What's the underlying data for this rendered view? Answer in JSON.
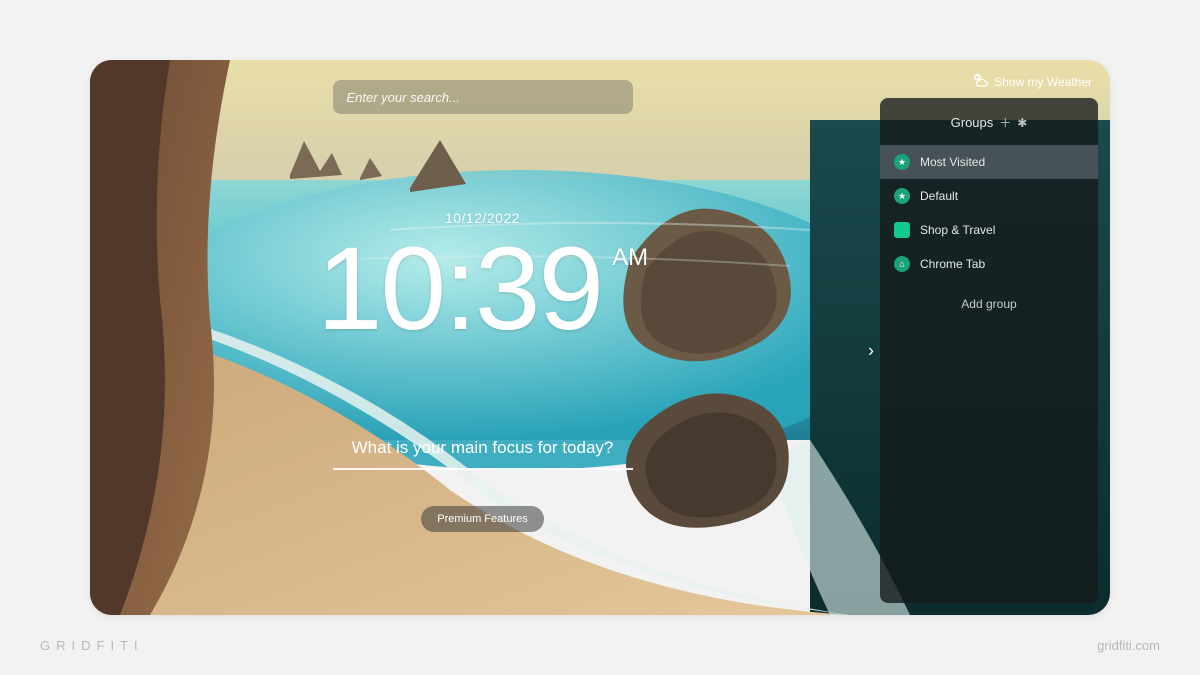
{
  "brand": {
    "left": "GRIDFITI",
    "right": "gridfiti.com"
  },
  "search": {
    "placeholder": "Enter your search..."
  },
  "weather": {
    "label": "Show my Weather"
  },
  "clock": {
    "date": "10/12/2022",
    "time": "10:39",
    "ampm": "AM"
  },
  "focus": {
    "prompt": "What is your main focus for today?"
  },
  "premium": {
    "label": "Premium Features"
  },
  "sidebar": {
    "title": "Groups",
    "add_label": "Add group",
    "items": [
      {
        "label": "Most Visited",
        "icon": "star",
        "active": true
      },
      {
        "label": "Default",
        "icon": "star",
        "active": false
      },
      {
        "label": "Shop & Travel",
        "icon": "square",
        "active": false
      },
      {
        "label": "Chrome Tab",
        "icon": "circle",
        "active": false
      }
    ]
  }
}
